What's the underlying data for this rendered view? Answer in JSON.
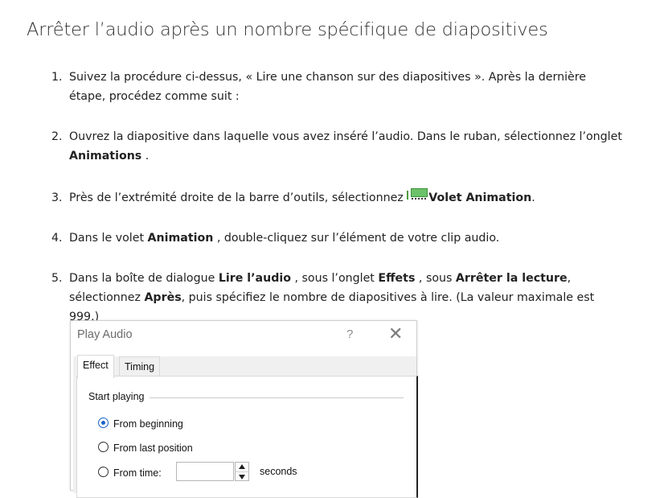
{
  "page": {
    "title": "Arrêter l’audio après un nombre spécifique de diapositives"
  },
  "steps": [
    {
      "num": "1.",
      "parts": [
        {
          "t": "Suivez la procédure ci-dessus, « Lire une chanson sur des diapositives ». Après la dernière étape, procédez comme suit :"
        }
      ]
    },
    {
      "num": "2.",
      "parts": [
        {
          "t": "Ouvrez la diapositive dans laquelle vous avez inséré l’audio. Dans le ruban, sélectionnez l’onglet "
        },
        {
          "t": "Animations",
          "b": true
        },
        {
          "t": " ."
        }
      ]
    },
    {
      "num": "3.",
      "parts": [
        {
          "t": "Près de l’extrémité droite de la barre d’outils, sélectionnez "
        },
        {
          "icon": "animation-pane-icon"
        },
        {
          "t": "Volet Animation",
          "b": true
        },
        {
          "t": "."
        }
      ]
    },
    {
      "num": "4.",
      "parts": [
        {
          "t": "Dans le volet "
        },
        {
          "t": "Animation",
          "b": true
        },
        {
          "t": " , double-cliquez sur l’élément de votre clip audio."
        }
      ]
    },
    {
      "num": "5.",
      "parts": [
        {
          "t": "Dans la boîte de dialogue "
        },
        {
          "t": "Lire l’audio",
          "b": true
        },
        {
          "t": " , sous l’onglet "
        },
        {
          "t": "Effets",
          "b": true
        },
        {
          "t": " , sous "
        },
        {
          "t": "Arrêter la lecture",
          "b": true
        },
        {
          "t": ", sélectionnez "
        },
        {
          "t": "Après",
          "b": true
        },
        {
          "t": ", puis spécifiez le nombre de diapositives à lire. (La valeur maximale est 999.)"
        }
      ]
    }
  ],
  "dialog": {
    "title": "Play Audio",
    "help": "?",
    "close": "✕",
    "tabs": [
      "Effect",
      "Timing"
    ],
    "active_tab": "Effect",
    "group_label": "Start playing",
    "options": [
      {
        "label": "From beginning",
        "checked": true
      },
      {
        "label": "From last position",
        "checked": false
      },
      {
        "label": "From time:",
        "checked": false
      }
    ],
    "time_value": "",
    "time_unit": "seconds"
  },
  "colors": {
    "radio_selected": "#1a64c6",
    "animation_icon": "#6cc26a"
  }
}
